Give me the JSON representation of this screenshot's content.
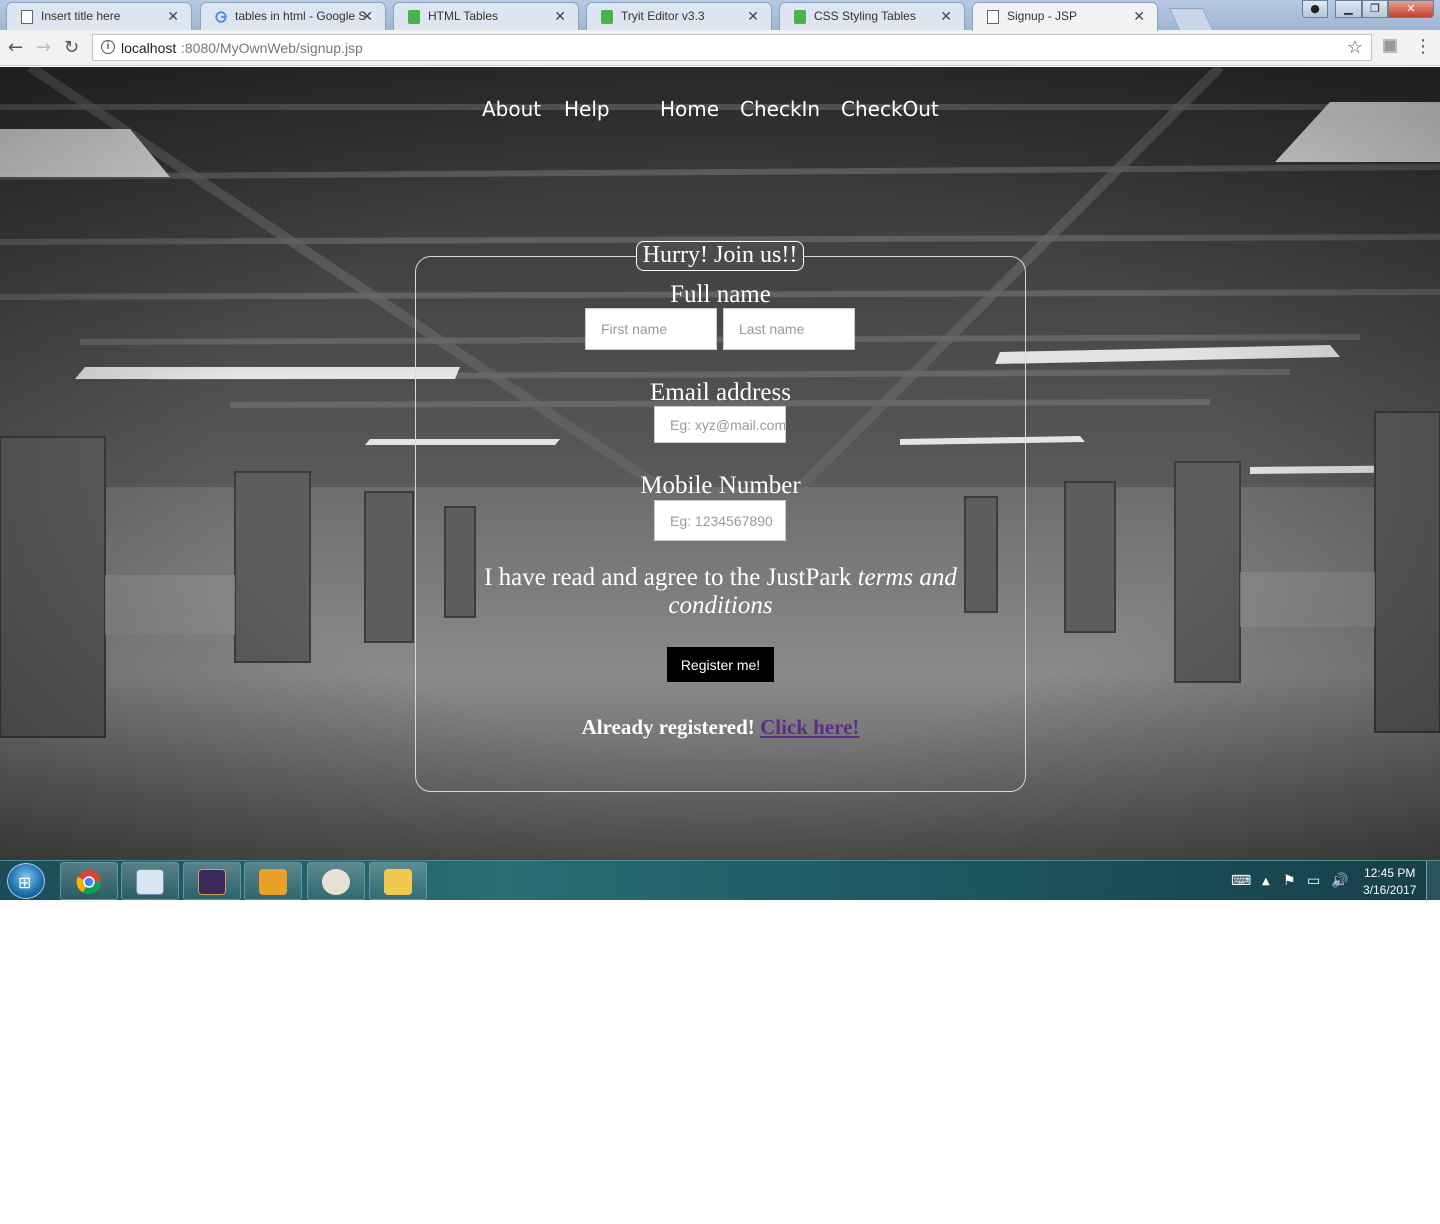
{
  "browser": {
    "tabs": [
      {
        "label": "Insert title here",
        "icon": "page-icon",
        "active": false
      },
      {
        "label": "tables in html - Google S",
        "icon": "google-icon",
        "active": false
      },
      {
        "label": "HTML Tables",
        "icon": "w3schools-icon",
        "active": false
      },
      {
        "label": "Tryit Editor v3.3",
        "icon": "w3schools-icon",
        "active": false
      },
      {
        "label": "CSS Styling Tables",
        "icon": "w3schools-icon",
        "active": false
      },
      {
        "label": "Signup - JSP",
        "icon": "page-icon",
        "active": true
      }
    ],
    "tab_close": "✕",
    "url_host": "localhost",
    "url_path": ":8080/MyOwnWeb/signup.jsp"
  },
  "site_nav": {
    "items": [
      "About",
      "Help",
      "Home",
      "CheckIn",
      "CheckOut"
    ]
  },
  "signup": {
    "legend": "Hurry! Join us!!",
    "full_name_label": "Full name",
    "first_name_placeholder": "First name",
    "last_name_placeholder": "Last name",
    "email_label": "Email address",
    "email_placeholder": "Eg: xyz@mail.com",
    "mobile_label": "Mobile Number",
    "mobile_placeholder": "Eg: 1234567890",
    "terms_prefix": "I have read and agree to the JustPark ",
    "terms_link": "terms and conditions",
    "register_button": "Register me!",
    "login_prefix": "Already registered! ",
    "login_link": "Click here!"
  },
  "taskbar": {
    "apps": [
      "chrome-icon",
      "network-app-icon",
      "java-ee-ide-icon",
      "outlook-icon",
      "paint-icon",
      "file-explorer-icon"
    ],
    "clock_time": "12:45 PM",
    "clock_date": "3/16/2017"
  },
  "colors": {
    "login_link": "#5a2d8c",
    "register_button_bg": "#000000",
    "taskbar": "#1f5a64"
  }
}
